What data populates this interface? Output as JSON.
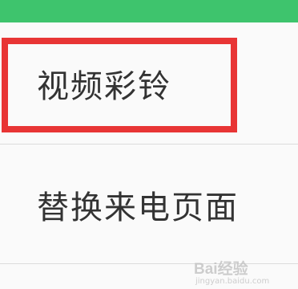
{
  "menu": {
    "items": [
      {
        "label": "视频彩铃"
      },
      {
        "label": "替换来电页面"
      }
    ]
  },
  "watermark": {
    "logo": "Bai经验",
    "url": "jingyan.baidu.com"
  },
  "colors": {
    "top_bar": "#3ec46d",
    "highlight_border": "#e83535",
    "text": "#333333",
    "divider": "#dcdcdc"
  }
}
